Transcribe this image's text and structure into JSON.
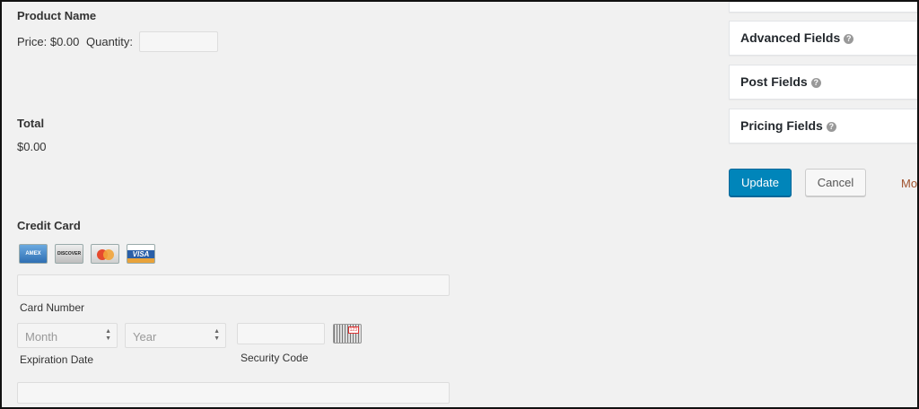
{
  "product": {
    "label": "Product Name",
    "price_text": "Price: $0.00",
    "quantity_label": "Quantity:",
    "quantity_value": ""
  },
  "total": {
    "label": "Total",
    "value": "$0.00"
  },
  "credit_card": {
    "label": "Credit Card",
    "cards": [
      {
        "name": "AMEX",
        "icon": "amex-card-icon"
      },
      {
        "name": "DISCOVER",
        "icon": "discover-card-icon"
      },
      {
        "name": "MasterCard",
        "icon": "mastercard-card-icon"
      },
      {
        "name": "VISA",
        "icon": "visa-card-icon"
      }
    ],
    "card_number_label": "Card Number",
    "month_placeholder": "Month",
    "year_placeholder": "Year",
    "expiration_label": "Expiration Date",
    "security_label": "Security Code",
    "cvv_sample": "123"
  },
  "sidebar": {
    "sections": [
      {
        "title": "Advanced Fields"
      },
      {
        "title": "Post Fields"
      },
      {
        "title": "Pricing Fields"
      }
    ],
    "help_glyph": "?",
    "update_label": "Update",
    "cancel_label": "Cancel",
    "more_label": "Mo"
  },
  "colors": {
    "primary": "#0085ba",
    "link": "#a0522d",
    "background": "#f1f1f1"
  }
}
